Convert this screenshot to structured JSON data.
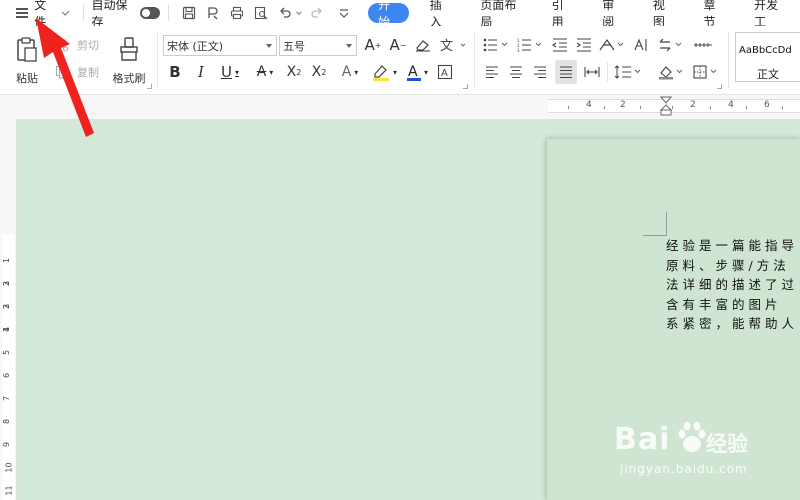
{
  "menubar": {
    "file_label": "文件",
    "autosave_label": "自动保存",
    "tabs": [
      {
        "label": "开始",
        "active": true
      },
      {
        "label": "插入"
      },
      {
        "label": "页面布局"
      },
      {
        "label": "引用"
      },
      {
        "label": "审阅"
      },
      {
        "label": "视图"
      },
      {
        "label": "章节"
      },
      {
        "label": "开发工"
      }
    ]
  },
  "ribbon": {
    "paste_label": "粘贴",
    "cut_label": "剪切",
    "copy_label": "复制",
    "format_painter_label": "格式刷",
    "font_name": "宋体 (正文)",
    "font_size": "五号",
    "style_preview": "AaBbCcDd",
    "style_name": "正文"
  },
  "ruler": {
    "h_numbers": [
      "4",
      "2",
      "2",
      "4",
      "6"
    ],
    "v_numbers": [
      "3",
      "2",
      "1",
      "1",
      "2",
      "3",
      "4",
      "5",
      "6",
      "7",
      "8",
      "9",
      "10",
      "11"
    ]
  },
  "document": {
    "lines": [
      "经验是一篇能指导",
      "原料、步骤/方法",
      "法详细的描述了过",
      "含有丰富的图片",
      "系紧密，能帮助人"
    ]
  },
  "watermark": {
    "brand": "Bai",
    "brand_cn": "经验",
    "url": "jingyan.baidu.com"
  },
  "colors": {
    "accent": "#3d86f0",
    "canvas_bg": "#d3e8d7",
    "annotation_arrow": "#f0221f"
  }
}
